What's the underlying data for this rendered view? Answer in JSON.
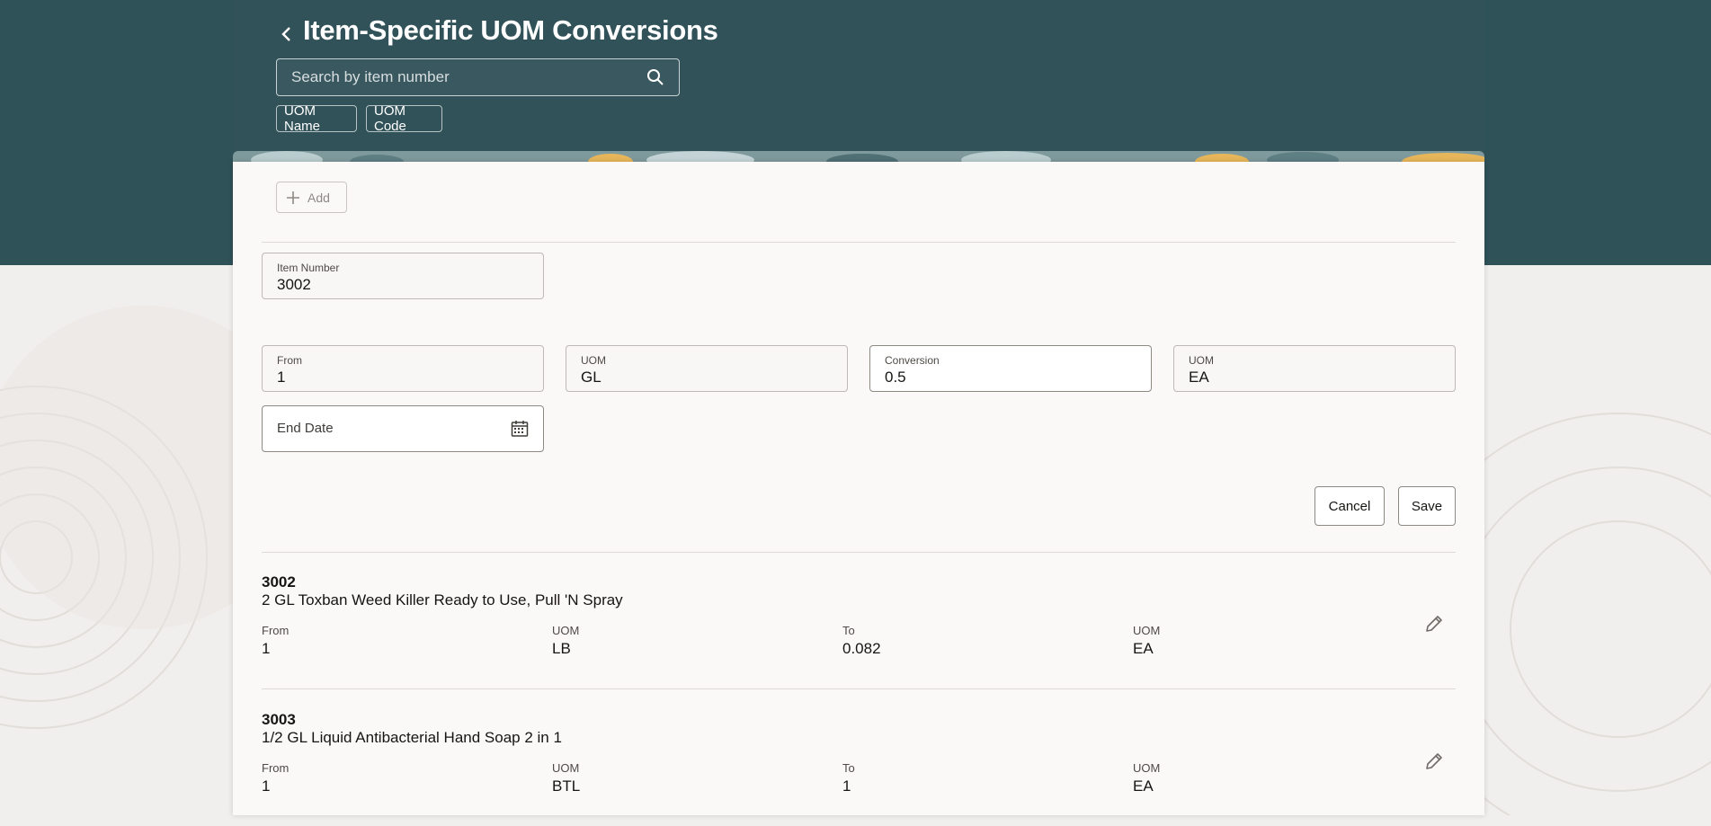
{
  "header": {
    "title": "Item-Specific UOM Conversions",
    "search_placeholder": "Search by item number",
    "chips": [
      "UOM Name",
      "UOM Code"
    ]
  },
  "toolbar": {
    "add_label": "Add"
  },
  "form": {
    "item_number": {
      "label": "Item Number",
      "value": "3002"
    },
    "from": {
      "label": "From",
      "value": "1"
    },
    "from_uom": {
      "label": "UOM",
      "value": "GL"
    },
    "conversion": {
      "label": "Conversion",
      "value": "0.5"
    },
    "to_uom": {
      "label": "UOM",
      "value": "EA"
    },
    "end_date": {
      "placeholder": "End Date"
    },
    "cancel_label": "Cancel",
    "save_label": "Save"
  },
  "list": {
    "columns": [
      "From",
      "UOM",
      "To",
      "UOM"
    ],
    "items": [
      {
        "number": "3002",
        "description": "2 GL Toxban Weed Killer Ready to Use, Pull 'N Spray",
        "from": "1",
        "from_uom": "LB",
        "to": "0.082",
        "to_uom": "EA"
      },
      {
        "number": "3003",
        "description": "1/2 GL Liquid Antibacterial Hand Soap 2 in 1",
        "from": "1",
        "from_uom": "BTL",
        "to": "1",
        "to_uom": "EA"
      }
    ]
  },
  "colors": {
    "header_bg": "#315259",
    "card_bg": "#fbf9f8",
    "page_bg": "#f1efed",
    "accent_gold": "#e8b65a"
  }
}
